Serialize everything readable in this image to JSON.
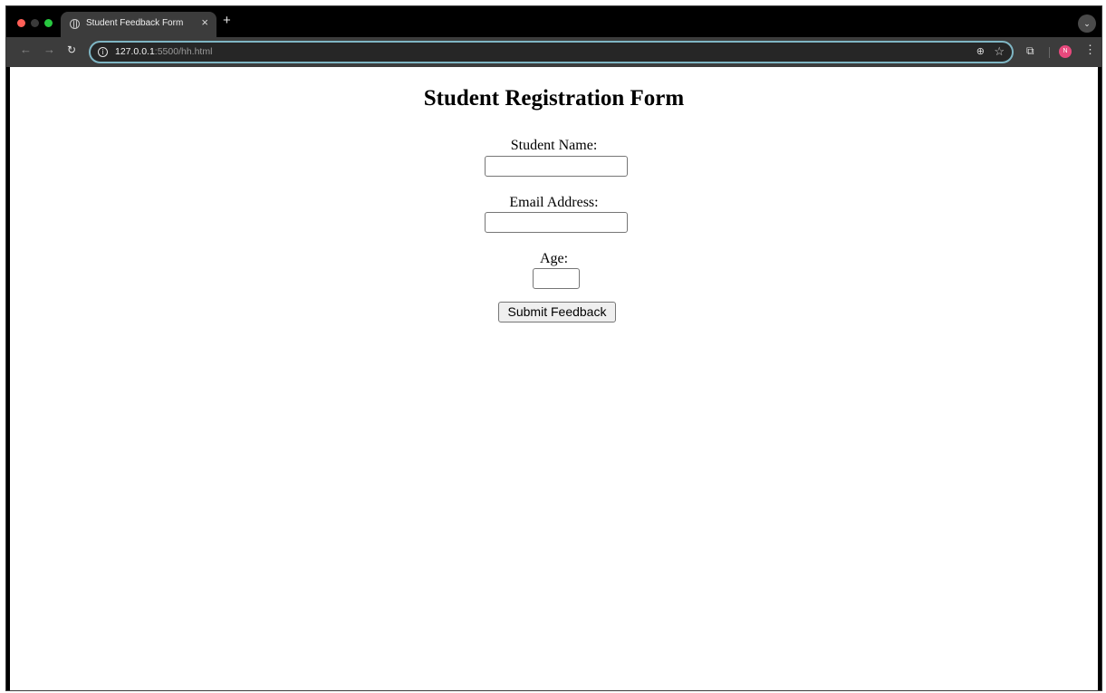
{
  "browser": {
    "tab_title": "Student Feedback Form",
    "tab_close": "×",
    "new_tab": "+",
    "tab_menu": "⌄",
    "url_host": "127.0.0.1",
    "url_rest": ":5500/hh.html",
    "profile_initial": "N",
    "icons": {
      "back": "back-arrow-icon",
      "forward": "forward-arrow-icon",
      "reload": "reload-icon",
      "info": "info-icon",
      "zoom": "zoom-icon",
      "bookmark": "star-icon",
      "extensions": "puzzle-icon",
      "menu": "kebab-menu-icon"
    },
    "accent_color": "#7fb6c4"
  },
  "form": {
    "title": "Student Registration Form",
    "fields": [
      {
        "label": "Student Name:",
        "value": ""
      },
      {
        "label": "Email Address:",
        "value": ""
      },
      {
        "label": "Age:",
        "value": ""
      }
    ],
    "submit_label": "Submit Feedback"
  }
}
